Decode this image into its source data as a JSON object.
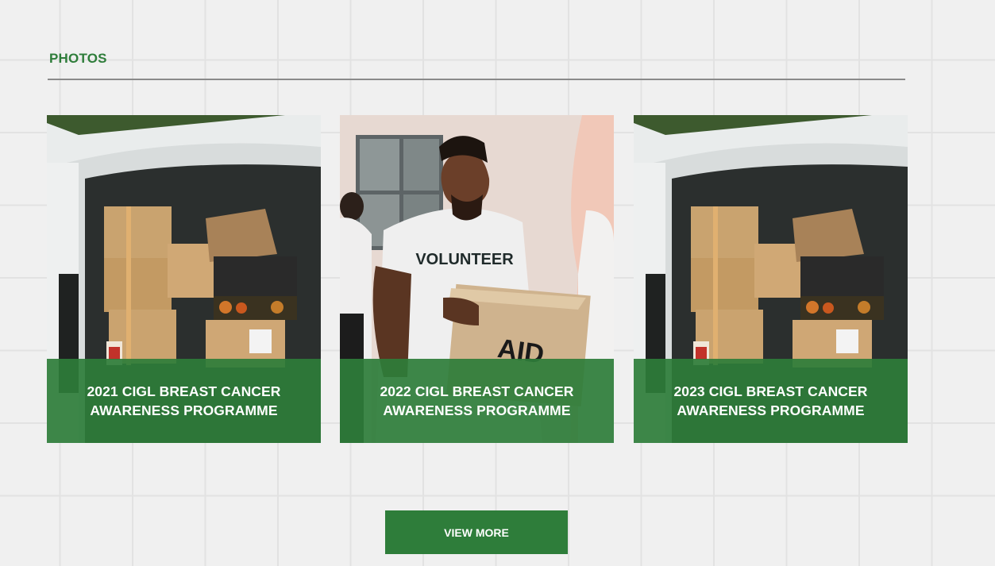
{
  "section": {
    "title": "PHOTOS"
  },
  "cards": [
    {
      "caption": "2021 CIGL BREAST CANCER AWARENESS PROGRAMME",
      "image": "delivery-van-boxes-photo"
    },
    {
      "caption": "2022 CIGL BREAST CANCER AWARENESS PROGRAMME",
      "image": "volunteer-holding-aid-box-photo",
      "box_text": "AID",
      "shirt_text": "VOLUNTEER"
    },
    {
      "caption": "2023 CIGL BREAST CANCER AWARENESS PROGRAMME",
      "image": "delivery-van-boxes-photo"
    }
  ],
  "actions": {
    "view_more": "VIEW MORE"
  },
  "colors": {
    "brand_green": "#2e7d3a",
    "background": "#f0f0f0"
  }
}
